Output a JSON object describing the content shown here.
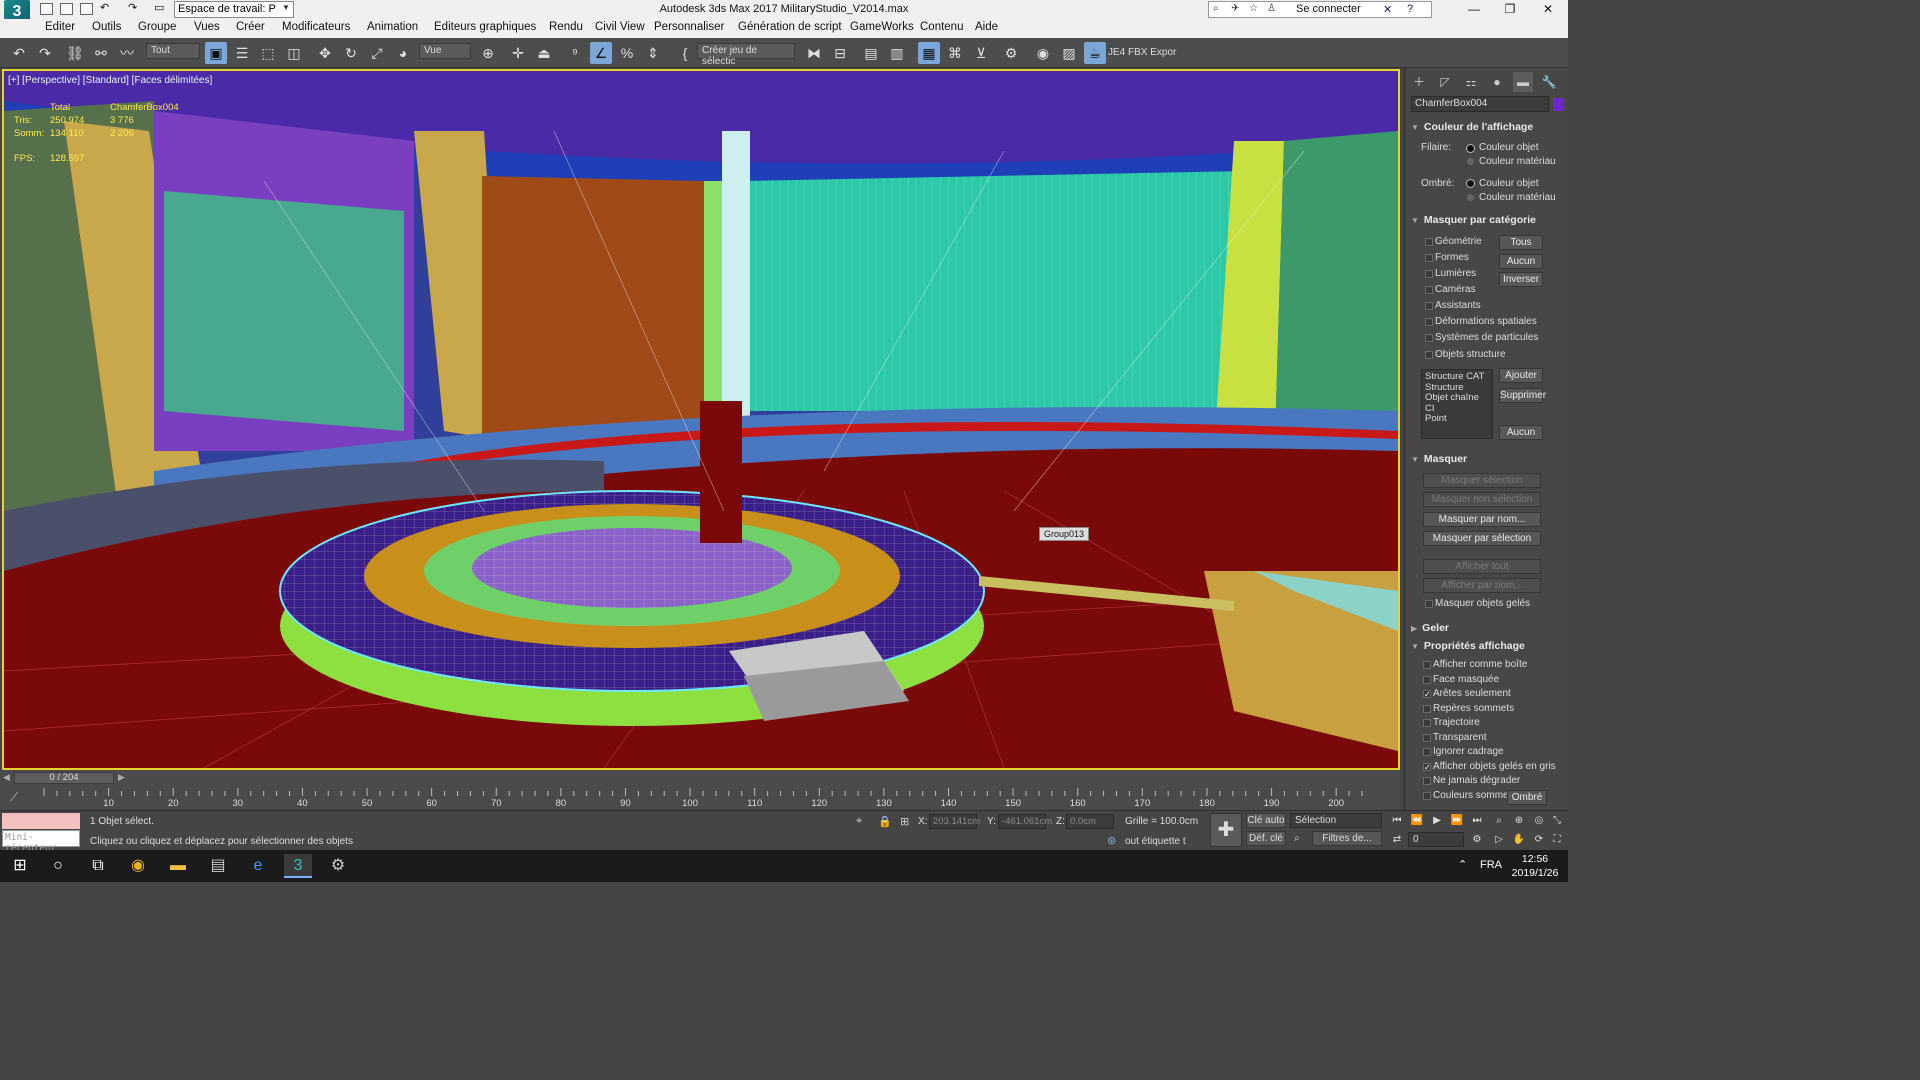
{
  "app": {
    "logo": "3",
    "workspace_label": "Espace de travail: P",
    "title": "Autodesk 3ds Max 2017      MilitaryStudio_V2014.max",
    "signin": "Se connecter"
  },
  "menu": [
    "Editer",
    "Outils",
    "Groupe",
    "Vues",
    "Créer",
    "Modificateurs",
    "Animation",
    "Editeurs graphiques",
    "Rendu",
    "Civil View",
    "Personnaliser",
    "Génération de script",
    "GameWorks",
    "Contenu",
    "Aide"
  ],
  "toolbar": {
    "filter": "Tout",
    "ref_coord": "Vue",
    "selection_set": "Créer jeu de sélectic",
    "fbx_label": "JE4 FBX Expor"
  },
  "viewport": {
    "label": "[+] [Perspective] [Standard] [Faces délimitées]",
    "stats": {
      "header_total": "Total",
      "header_object": "ChamferBox004",
      "tris_label": "Tris:",
      "tris_total": "250 974",
      "tris_object": "3 776",
      "verts_label": "Somm:",
      "verts_total": "134 110",
      "verts_object": "2 206",
      "fps_label": "FPS:",
      "fps_value": "128.597"
    },
    "group_tag": "Group013"
  },
  "command_panel": {
    "object_name": "ChamferBox004",
    "object_color": "#6b28c8",
    "display_color": {
      "title": "Couleur de l'affichage",
      "wireframe_label": "Filaire:",
      "shaded_label": "Ombré:",
      "option_object": "Couleur objet",
      "option_material": "Couleur matériau"
    },
    "hide_by_category": {
      "title": "Masquer par catégorie",
      "items": [
        "Géométrie",
        "Formes",
        "Lumières",
        "Caméras",
        "Assistants",
        "Déformations spatiales",
        "Systèmes de particules",
        "Objets structure"
      ],
      "btn_all": "Tous",
      "btn_none": "Aucun",
      "btn_invert": "Inverser",
      "list": [
        "Structure CAT",
        "Structure",
        "Objet chaîne CI",
        "Point"
      ],
      "btn_add": "Ajouter",
      "btn_remove": "Supprimer",
      "btn_none2": "Aucun"
    },
    "hide": {
      "title": "Masquer",
      "buttons": [
        "Masquer sélection",
        "Masquer non sélection",
        "Masquer par nom...",
        "Masquer par sélection",
        "Afficher tout",
        "Afficher par nom..."
      ],
      "hide_frozen": "Masquer objets gelés"
    },
    "freeze": {
      "title": "Geler"
    },
    "display_props": {
      "title": "Propriétés affichage",
      "items": [
        "Afficher comme boîte",
        "Face masquée",
        "Arêtes seulement",
        "Repères sommets",
        "Trajectoire",
        "Transparent",
        "Ignorer cadrage",
        "Afficher objets gelés en gris",
        "Ne jamais dégrader",
        "Couleurs sommet"
      ],
      "shaded_btn": "Ombré"
    }
  },
  "timeline": {
    "frame_display": "0 / 204",
    "ticks": [
      "10",
      "20",
      "30",
      "40",
      "50",
      "60",
      "70",
      "80",
      "90",
      "100",
      "110",
      "120",
      "130",
      "140",
      "150",
      "160",
      "170",
      "180",
      "190",
      "200"
    ]
  },
  "status": {
    "mini_listener": "Mini-récepteur",
    "selection": "1 Objet sélect.",
    "prompt": "Cliquez ou cliquez et déplacez pour sélectionner des objets",
    "x_label": "X:",
    "x_value": "203.141cm",
    "y_label": "Y:",
    "y_value": "-461.061cm",
    "z_label": "Z:",
    "z_value": "0.0cm",
    "grid": "Grille = 100.0cm",
    "add_time_tag": "out étiquette t",
    "auto_key": "Clé auto",
    "set_key": "Déf. clé",
    "selection_dropdown": "Sélection",
    "key_filters": "Filtres de...",
    "frame_value": "0"
  },
  "taskbar": {
    "lang": "FRA",
    "time": "12:56",
    "date": "2019/1/26"
  }
}
